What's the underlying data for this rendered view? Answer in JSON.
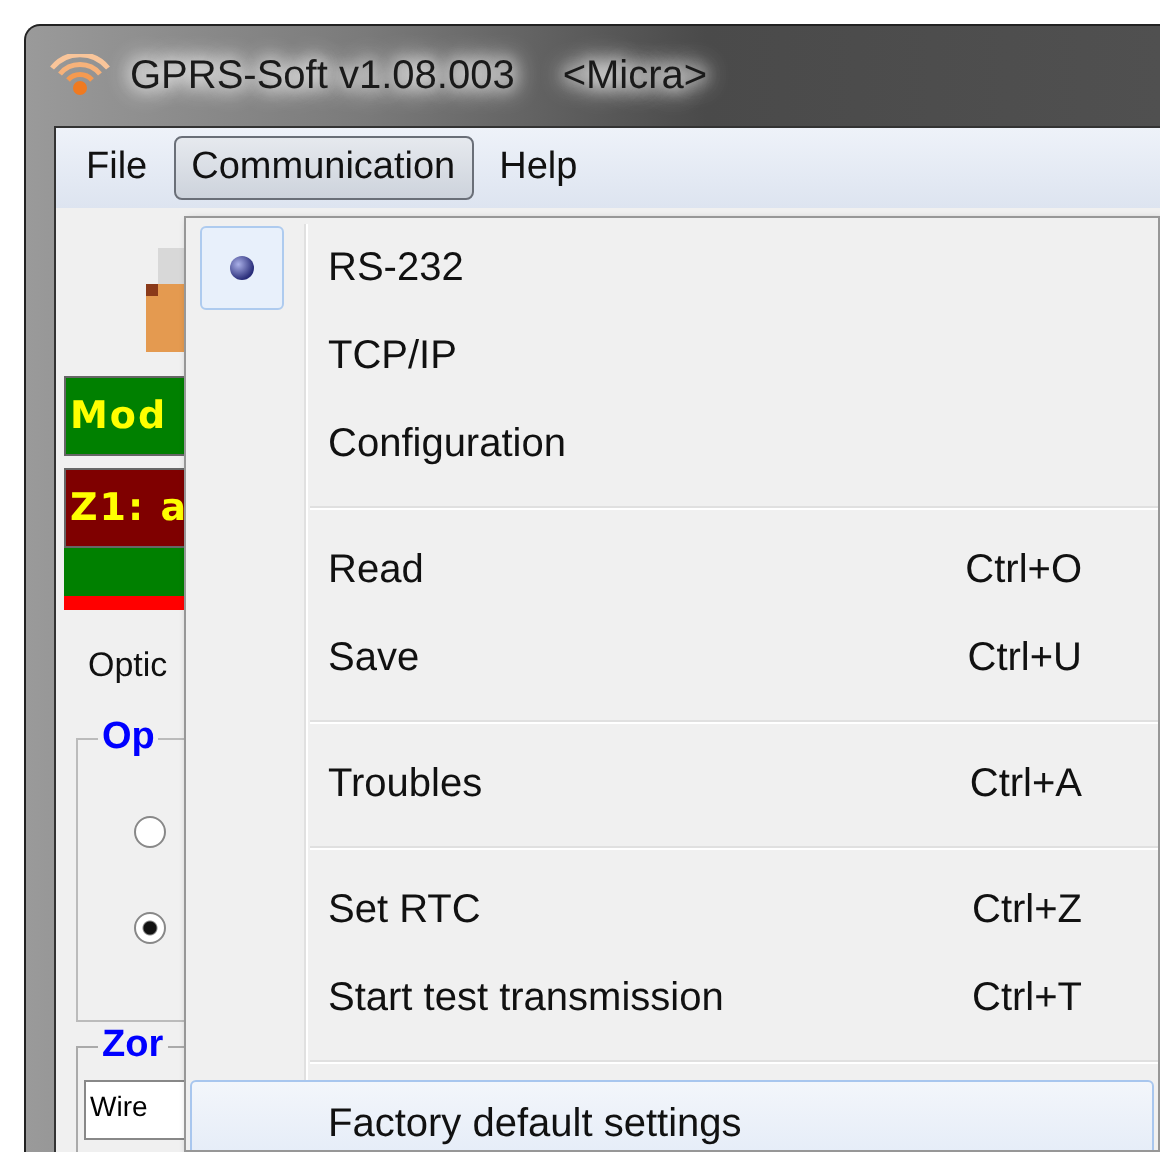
{
  "window": {
    "title": "GPRS-Soft v1.08.003",
    "subtitle": "<Micra>"
  },
  "menu_bar": [
    {
      "label": "File",
      "selected": false
    },
    {
      "label": "Communication",
      "selected": true
    },
    {
      "label": "Help",
      "selected": false
    }
  ],
  "background": {
    "status_bars": [
      {
        "kind": "label",
        "text": "Mod",
        "color": "#008000"
      },
      {
        "kind": "label",
        "text": "Z1: a",
        "color": "#7f0000"
      },
      {
        "kind": "strip",
        "color": "#008000"
      },
      {
        "kind": "thin",
        "color": "#ff0000"
      }
    ],
    "tab_label": "Optic",
    "options_group": {
      "title": "Op",
      "radios": [
        {
          "selected": false
        },
        {
          "selected": true
        }
      ]
    },
    "zone_group": {
      "title": "Zor",
      "field_value": "Wire"
    }
  },
  "menu": {
    "groups": [
      {
        "items": [
          {
            "kind": "radio",
            "label": "RS-232",
            "selected": true,
            "highlighted": false
          },
          {
            "kind": "radio",
            "label": "TCP/IP",
            "selected": false,
            "highlighted": false
          },
          {
            "kind": "command",
            "label": "Configuration",
            "highlighted": false
          }
        ]
      },
      {
        "items": [
          {
            "kind": "command",
            "label": "Read",
            "shortcut": "Ctrl+O",
            "highlighted": false
          },
          {
            "kind": "command",
            "label": "Save",
            "shortcut": "Ctrl+U",
            "highlighted": false
          }
        ]
      },
      {
        "items": [
          {
            "kind": "command",
            "label": "Troubles",
            "shortcut": "Ctrl+A",
            "highlighted": false
          }
        ]
      },
      {
        "items": [
          {
            "kind": "command",
            "label": "Set RTC",
            "shortcut": "Ctrl+Z",
            "highlighted": false
          },
          {
            "kind": "command",
            "label": "Start test transmission",
            "shortcut": "Ctrl+T",
            "highlighted": false
          }
        ]
      },
      {
        "items": [
          {
            "kind": "command",
            "label": "Factory default settings",
            "highlighted": true
          }
        ]
      }
    ]
  }
}
